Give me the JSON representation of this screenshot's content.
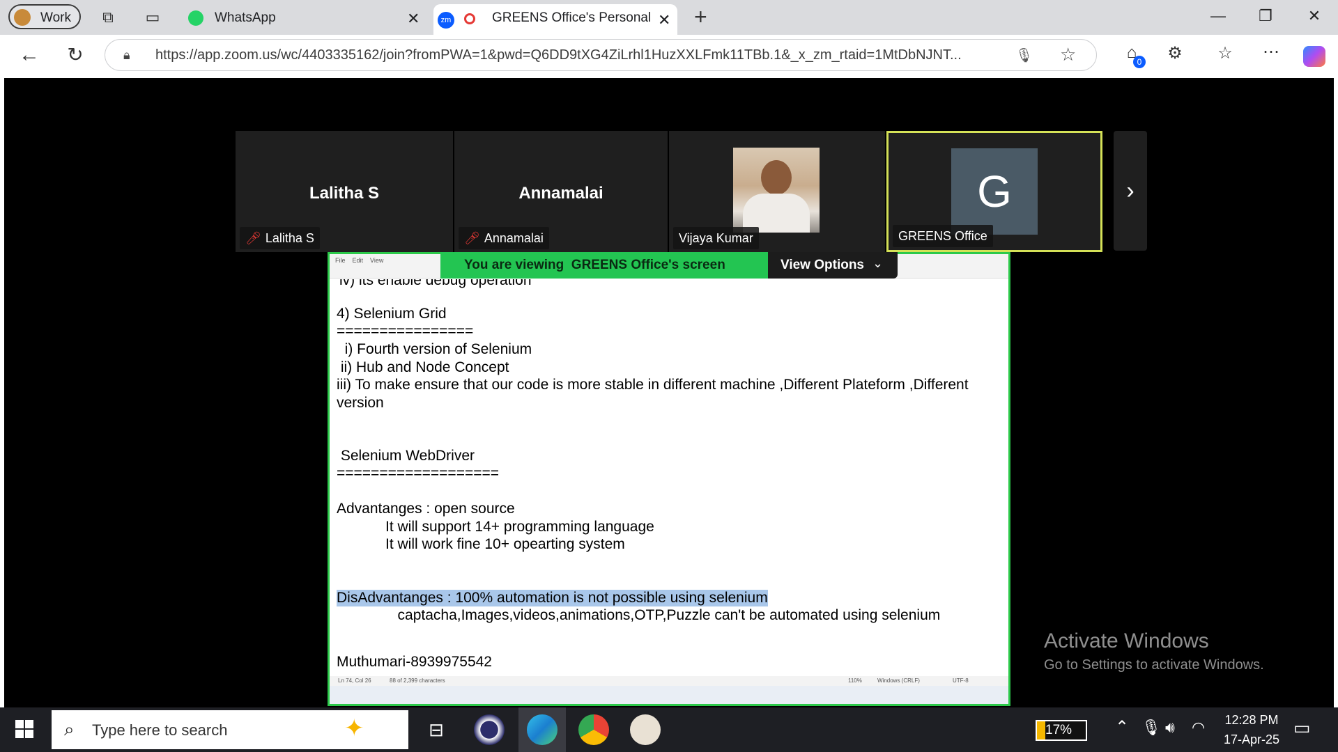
{
  "browser": {
    "profile_label": "Work",
    "tabs": [
      {
        "title": "WhatsApp"
      },
      {
        "title": "GREENS Office's Personal Me"
      }
    ],
    "url": "https://app.zoom.us/wc/4403335162/join?fromPWA=1&pwd=Q6DD9tXG4ZiLrhl1HuzXXLFmk11TBb.1&_x_zm_rtaid=1MtDbNJNT...",
    "extensions_badge": "0"
  },
  "participants": [
    {
      "display": "Lalitha S",
      "label": "Lalitha S",
      "muted": true
    },
    {
      "display": "Annamalai",
      "label": "Annamalai",
      "muted": true
    },
    {
      "display": "",
      "label": "Vijaya Kumar",
      "muted": false
    },
    {
      "display": "G",
      "label": "GREENS Office",
      "muted": false
    }
  ],
  "share_bar": {
    "viewing_text": "You are viewing  GREENS Office's screen",
    "view_options": "View Options"
  },
  "shared_doc": {
    "lines": [
      "4) Selenium Grid",
      "================",
      "  i) Fourth version of Selenium",
      " ii) Hub and Node Concept",
      "iii) To make ensure that our code is more stable in different machine ,Different Plateform ,Different",
      "version",
      " Selenium WebDriver",
      "===================",
      "Advantanges : open source",
      "            It will support 14+ programming language",
      "            It will work fine 10+ opearting system",
      "DisAdvantanges : 100% automation is not possible using selenium",
      "               captacha,Images,videos,animations,OTP,Puzzle can't be automated using selenium",
      "Muthumari-8939975542"
    ],
    "status_left": "Ln 74, Col 26",
    "status_chars": "88 of 2,399 characters",
    "status_zoom": "110%",
    "status_eol": "Windows (CRLF)",
    "status_enc": "UTF-8"
  },
  "watermark": {
    "title": "Activate Windows",
    "subtitle": "Go to Settings to activate Windows."
  },
  "taskbar": {
    "search_placeholder": "Type here to search",
    "battery": "17%",
    "time": "12:28 PM",
    "date": "17-Apr-25"
  },
  "colors": {
    "share_green": "#23c552",
    "active_speaker": "#d4e157",
    "tile_bg": "#1f1f1f"
  }
}
